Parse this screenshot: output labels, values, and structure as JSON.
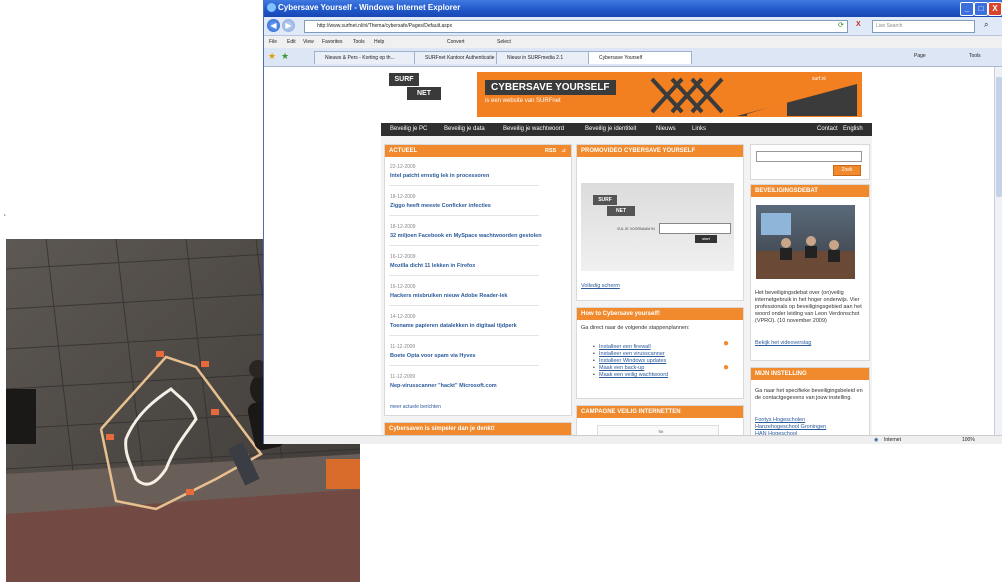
{
  "window": {
    "title": "Cybersave Yourself - Windows Internet Explorer",
    "address": "http://www.surfnet.nl/nl/Thema/cybersafe/Pages/Default.aspx",
    "search_placeholder": "Live Search",
    "minimize": "_",
    "maximize": "□",
    "close": "X",
    "back": "◀",
    "forward": "▶",
    "refresh": "⟳",
    "stop": "X",
    "go": "⌕"
  },
  "menubar": {
    "items": [
      "File",
      "Edit",
      "View",
      "Favorites",
      "Tools",
      "Help"
    ],
    "convert": "Convert",
    "select": "Select"
  },
  "tabs": [
    "Nieuws & Pers - Korting op th...",
    "SURFnet Kantoor Authenticatie",
    "Nieuw in SURFmedia 2.1",
    "Cybersave Yourself"
  ],
  "toolbar": {
    "page": "Page",
    "tools": "Tools"
  },
  "site": {
    "logo_top": "SURF",
    "logo_bottom": "NET",
    "banner_title": "CYBERSAVE YOURSELF",
    "banner_sub": "is een website van SURFnet",
    "banner_small": "surf.nl",
    "nav": [
      "Beveilig je PC",
      "Beveilig je data",
      "Beveilig je wachtwoord",
      "Beveilig je identiteit",
      "Nieuws",
      "Links"
    ],
    "nav_right": [
      "Contact",
      "English"
    ],
    "actueel": {
      "heading": "ACTUEEL",
      "rss": "RSS",
      "items": [
        {
          "date": "22-12-2009",
          "title": "Intel patcht ernstig lek in processoren"
        },
        {
          "date": "18-12-2009",
          "title": "Ziggo heeft meeste Conficker infecties"
        },
        {
          "date": "18-12-2009",
          "title": "32 miljoen Facebook en MySpace wachtwoorden gestolen"
        },
        {
          "date": "16-12-2009",
          "title": "Mozilla dicht 11 lekken in Firefox"
        },
        {
          "date": "16-12-2009",
          "title": "Hackers misbruiken nieuw Adobe Reader-lek"
        },
        {
          "date": "14-12-2009",
          "title": "Toename papieren datalekken in digitaal tijdperk"
        },
        {
          "date": "11-12-2009",
          "title": "Boete Opta voor spam via Hyves"
        },
        {
          "date": "11-12-2009",
          "title": "Nep-virusscanner \"hackt\" Microsoft.com"
        }
      ],
      "more": "meer actuele berichten"
    },
    "cyber_simpel": "Cybersaven is simpeler dan je denkt!",
    "promo": {
      "heading": "PROMOVIDEO CYBERSAVE YOURSELF",
      "video_logo_top": "SURF",
      "video_logo_bottom": "NET",
      "video_prompt": "VUL JE VOORNAAM IN",
      "video_btn": "start",
      "fullscreen": "Volledig scherm"
    },
    "howto": {
      "heading": "How to Cybersave yourself!",
      "intro": "Ga direct naar de volgende stappenplannen:",
      "items": [
        "Installeer een firewall",
        "Installeer een virusscanner",
        "Installeer Windows updates",
        "Maak een back-up",
        "Maak een veilig wachtwoord"
      ]
    },
    "campagne": {
      "heading": "CAMPAGNE VEILIG INTERNETTEN",
      "tile": "Tilt"
    },
    "right": {
      "search_btn": "Zoek",
      "debat_heading": "BEVEILIGINGSDEBAT",
      "debat_text": "Het beveiligingsdebat over (on)veilig internetgebruik in het hoger onderwijs. Vier professionals op beveiligingsgebied aan het woord onder leiding van Leon Verdonschot (VPRO). (10 november 2009)",
      "debat_link": "Bekijk het videoverslag",
      "mijn_heading": "MIJN INSTELLING",
      "mijn_text": "Ga naar het specifieke beveiligingsbeleid en de contactgegevens van jouw instelling.",
      "links": [
        "Fontys Hogescholen",
        "Hanzehogeschool Groningen",
        "HAN Hogeschool"
      ]
    }
  },
  "status": {
    "zone": "Internet",
    "zoom": "100%"
  },
  "colors": {
    "accent": "#f08a2c",
    "link": "#2b5a9b",
    "titlebar": "#1f56c8"
  },
  "stray_mark": "‘"
}
